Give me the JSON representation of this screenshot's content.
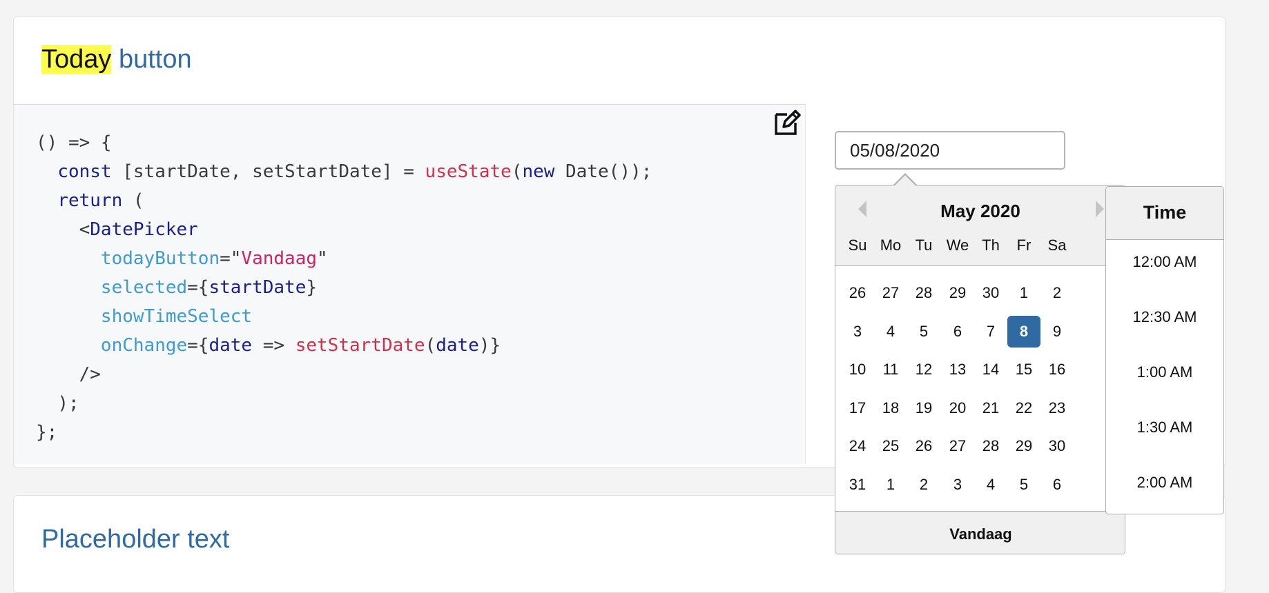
{
  "sections": [
    {
      "title_highlight": "Today",
      "title_rest": " button"
    },
    {
      "title": "Placeholder text"
    }
  ],
  "code": {
    "l1": "() => {",
    "l2": {
      "kw": "const",
      "mid": " [startDate, setStartDate] = ",
      "fn": "useState",
      "p1": "(",
      "kw2": "new",
      "end": " Date());"
    },
    "l3": {
      "kw": "return",
      "end": " ("
    },
    "l4": {
      "open": "<",
      "tag": "DatePicker"
    },
    "l5": {
      "attr": "todayButton",
      "eq": "=\"",
      "str": "Vandaag",
      "close": "\""
    },
    "l6": {
      "attr": "selected",
      "eq": "={",
      "var": "startDate",
      "close": "}"
    },
    "l7": {
      "attr": "showTimeSelect"
    },
    "l8": {
      "attr": "onChange",
      "eq": "={",
      "var": "date",
      "arrow": " => ",
      "fn": "setStartDate",
      "p1": "(",
      "var2": "date",
      "close": ")}"
    },
    "l9": "/>",
    "l10": ");",
    "l11": "};"
  },
  "icons": {
    "edit": "edit-icon",
    "prev": "chevron-left-icon",
    "next": "chevron-right-icon"
  },
  "date_input": {
    "value": "05/08/2020"
  },
  "calendar": {
    "month": "May 2020",
    "weekdays": [
      "Su",
      "Mo",
      "Tu",
      "We",
      "Th",
      "Fr",
      "Sa"
    ],
    "weeks": [
      [
        "26",
        "27",
        "28",
        "29",
        "30",
        "1",
        "2"
      ],
      [
        "3",
        "4",
        "5",
        "6",
        "7",
        "8",
        "9"
      ],
      [
        "10",
        "11",
        "12",
        "13",
        "14",
        "15",
        "16"
      ],
      [
        "17",
        "18",
        "19",
        "20",
        "21",
        "22",
        "23"
      ],
      [
        "24",
        "25",
        "26",
        "27",
        "28",
        "29",
        "30"
      ],
      [
        "31",
        "1",
        "2",
        "3",
        "4",
        "5",
        "6"
      ]
    ],
    "selected": "8",
    "today_button": "Vandaag",
    "accent_color": "#2f6aa3"
  },
  "time": {
    "title": "Time",
    "options": [
      "12:00 AM",
      "12:30 AM",
      "1:00 AM",
      "1:30 AM",
      "2:00 AM"
    ]
  }
}
